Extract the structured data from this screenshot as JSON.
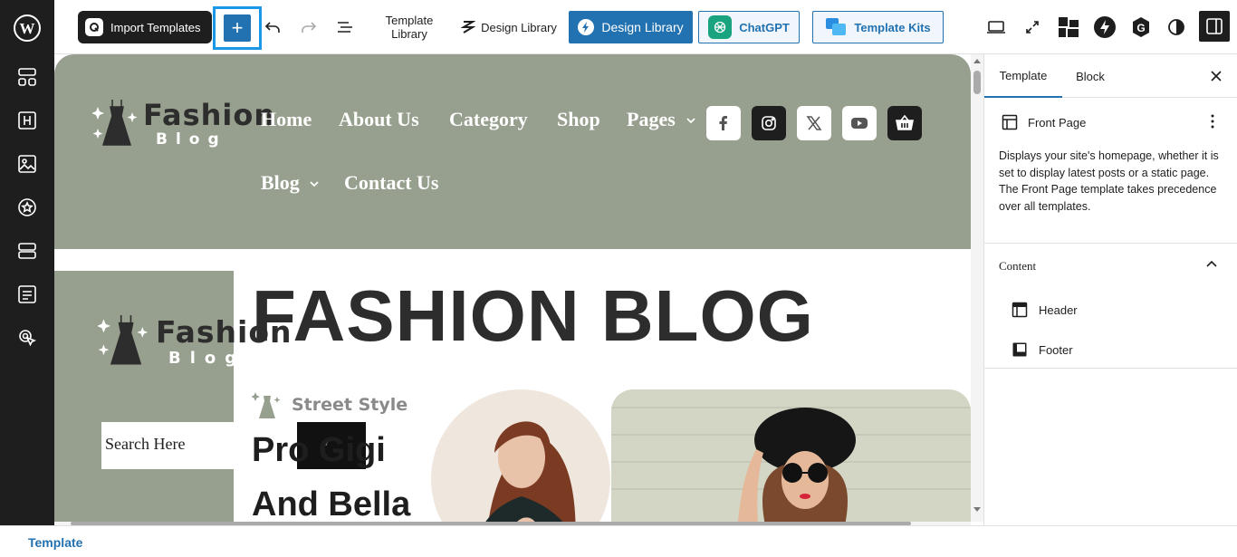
{
  "toolbar": {
    "import_templates": "Import Templates",
    "template_library": "Template Library",
    "design_library_plain": "Design Library",
    "design_library_button": "Design Library",
    "chatgpt": "ChatGPT",
    "template_kits": "Template Kits"
  },
  "site": {
    "logo_word": "Fashion",
    "logo_sub": "Blog",
    "nav": [
      "Home",
      "About Us",
      "Category",
      "Shop",
      "Pages",
      "Blog",
      "Contact Us"
    ],
    "hero_title": "FASHION BLOG",
    "search_placeholder": "Search Here",
    "tag": "Street Style",
    "heading_line1": "Pro Gigi",
    "heading_line2": "And Bella"
  },
  "panel": {
    "tab_template": "Template",
    "tab_block": "Block",
    "page_title": "Front Page",
    "description": "Displays your site's homepage, whether it is set to display latest posts or a static page. The Front Page template takes precedence over all templates.",
    "content_heading": "Content",
    "items": [
      "Header",
      "Footer"
    ]
  },
  "footer": {
    "breadcrumb": "Template"
  },
  "colors": {
    "accent": "#2271b1",
    "sage": "#97a08f",
    "dark": "#1e1e1e"
  }
}
